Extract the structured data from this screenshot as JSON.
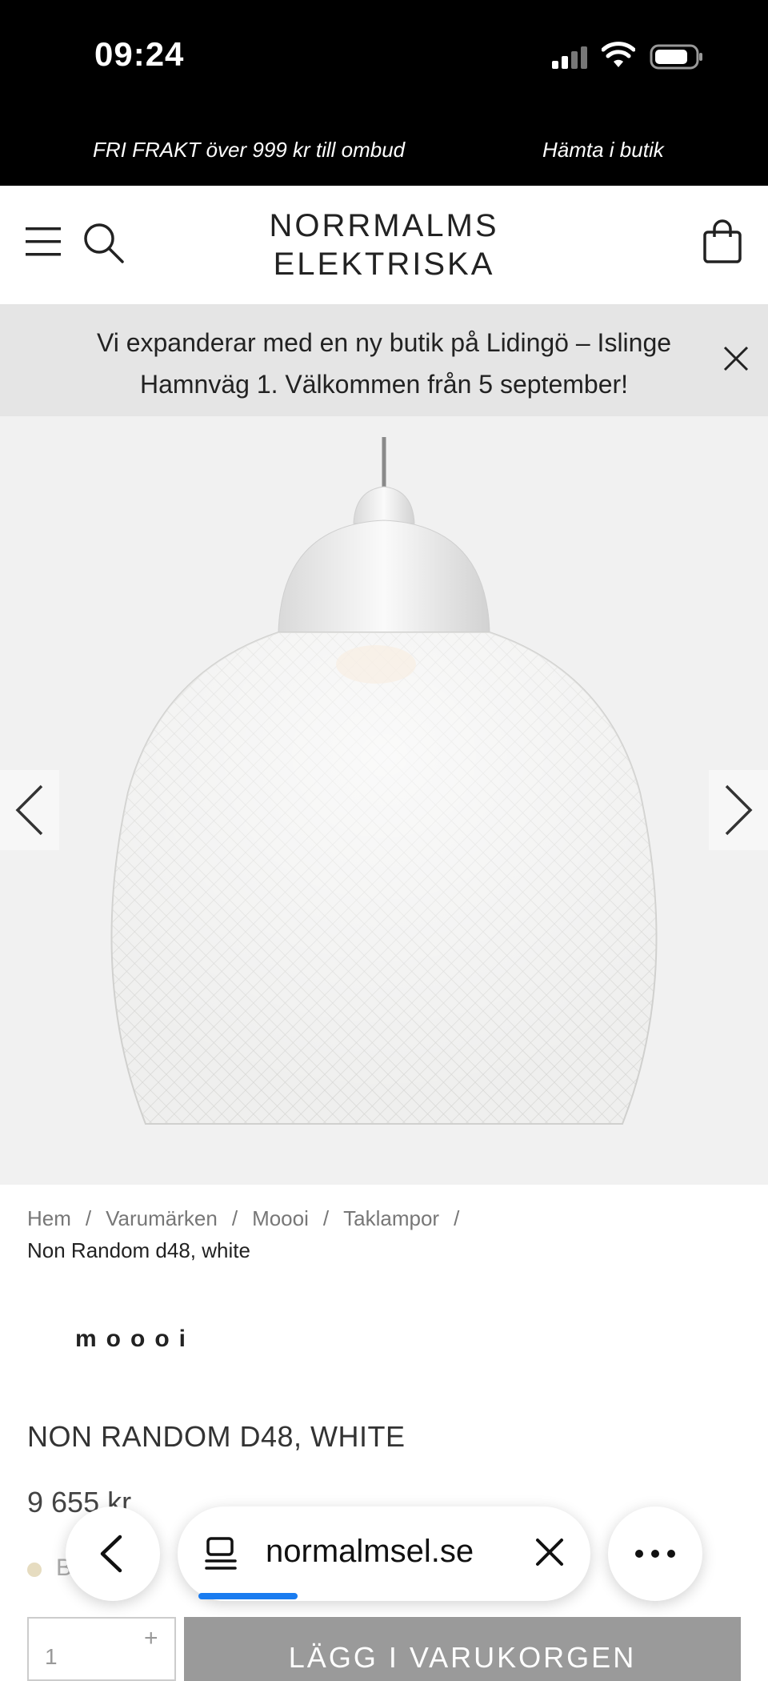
{
  "status_bar": {
    "time": "09:24"
  },
  "promo": {
    "left": "FRI FRAKT över 999 kr till ombud",
    "right": "Hämta i butik"
  },
  "header": {
    "logo_line1": "NORRMALMS",
    "logo_line2": "ELEKTRISKA"
  },
  "banner": {
    "text": "Vi expanderar med en ny butik på Lidingö – Islinge Hamnväg 1. Välkommen från 5 september!"
  },
  "breadcrumb": {
    "items": [
      "Hem",
      "Varumärken",
      "Moooi",
      "Taklampor"
    ],
    "separator": "/",
    "current": "Non Random d48, white"
  },
  "product": {
    "brand": "moooi",
    "title": "NON RANDOM D48, WHITE",
    "price": "9 655 kr",
    "stock_text": "B",
    "quantity": "1",
    "qty_plus": "+",
    "add_to_cart": "LÄGG I VARUKORGEN"
  },
  "browser": {
    "url": "normalmsel.se"
  },
  "colors": {
    "statusbar_bg": "#000000",
    "banner_bg": "#e5e5e5",
    "button_bg": "#9a9a9a",
    "progress": "#1a7cf0"
  }
}
